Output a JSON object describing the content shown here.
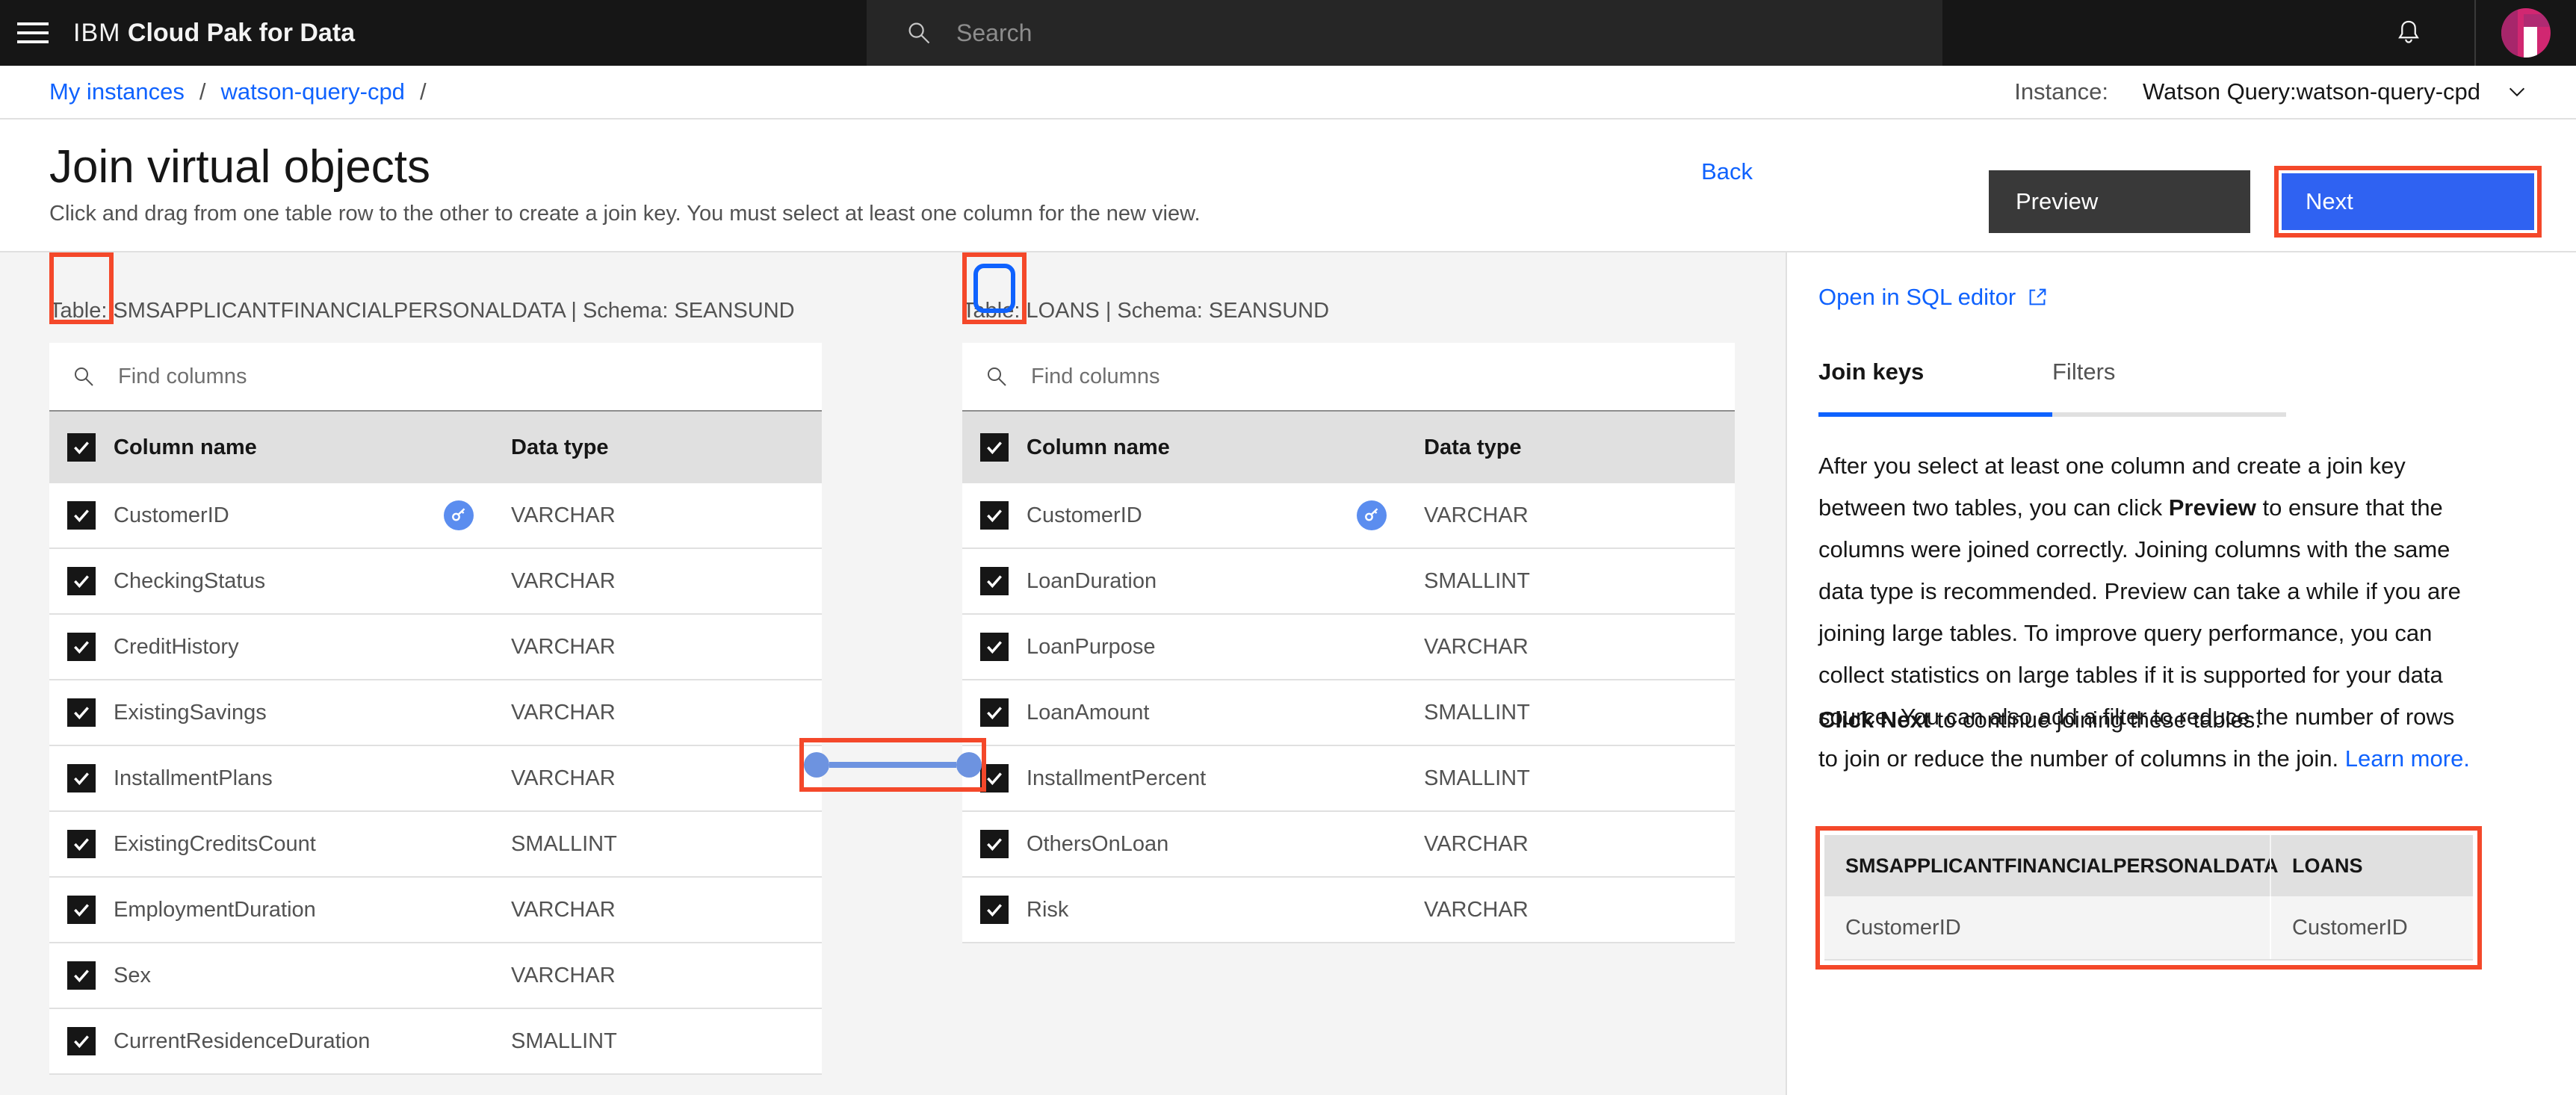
{
  "topbar": {
    "menu_icon": "hamburger-menu-icon",
    "brand_light": "IBM",
    "brand_bold": "Cloud Pak for Data",
    "search_placeholder": "Search",
    "search_icon": "search-icon",
    "notifications_icon": "bell-icon",
    "avatar": "user-avatar"
  },
  "breadcrumb": {
    "items": [
      {
        "label": "My instances"
      },
      {
        "label": "watson-query-cpd"
      }
    ],
    "separator": "/",
    "instance_label": "Instance:",
    "instance_value": "Watson Query:watson-query-cpd",
    "chevron_icon": "chevron-down-icon"
  },
  "page": {
    "title": "Join virtual objects",
    "subtitle": "Click and drag from one table row to the other to create a join key. You must select at least one column for the new view.",
    "back_label": "Back",
    "preview_label": "Preview",
    "next_label": "Next"
  },
  "tables": [
    {
      "caption": "Table: SMSAPPLICANTFINANCIALPERSONALDATA | Schema: SEANSUND",
      "find_placeholder": "Find columns",
      "find_icon": "search-icon",
      "header_col_name": "Column name",
      "header_col_type": "Data type",
      "header_checked": true,
      "rows": [
        {
          "name": "CustomerID",
          "type": "VARCHAR",
          "checked": true,
          "key": true
        },
        {
          "name": "CheckingStatus",
          "type": "VARCHAR",
          "checked": true,
          "key": false
        },
        {
          "name": "CreditHistory",
          "type": "VARCHAR",
          "checked": true,
          "key": false
        },
        {
          "name": "ExistingSavings",
          "type": "VARCHAR",
          "checked": true,
          "key": false
        },
        {
          "name": "InstallmentPlans",
          "type": "VARCHAR",
          "checked": true,
          "key": false
        },
        {
          "name": "ExistingCreditsCount",
          "type": "SMALLINT",
          "checked": true,
          "key": false
        },
        {
          "name": "EmploymentDuration",
          "type": "VARCHAR",
          "checked": true,
          "key": false
        },
        {
          "name": "Sex",
          "type": "VARCHAR",
          "checked": true,
          "key": false
        },
        {
          "name": "CurrentResidenceDuration",
          "type": "SMALLINT",
          "checked": true,
          "key": false
        }
      ]
    },
    {
      "caption": "Table: LOANS | Schema: SEANSUND",
      "find_placeholder": "Find columns",
      "find_icon": "search-icon",
      "header_col_name": "Column name",
      "header_col_type": "Data type",
      "header_checked": true,
      "rows": [
        {
          "name": "CustomerID",
          "type": "VARCHAR",
          "checked": true,
          "key": true
        },
        {
          "name": "LoanDuration",
          "type": "SMALLINT",
          "checked": true,
          "key": false
        },
        {
          "name": "LoanPurpose",
          "type": "VARCHAR",
          "checked": true,
          "key": false
        },
        {
          "name": "LoanAmount",
          "type": "SMALLINT",
          "checked": true,
          "key": false
        },
        {
          "name": "InstallmentPercent",
          "type": "SMALLINT",
          "checked": true,
          "key": false
        },
        {
          "name": "OthersOnLoan",
          "type": "VARCHAR",
          "checked": true,
          "key": false
        },
        {
          "name": "Risk",
          "type": "VARCHAR",
          "checked": true,
          "key": false
        }
      ]
    }
  ],
  "side_panel": {
    "sql_link": "Open in SQL editor",
    "sql_link_icon": "external-link-icon",
    "tabs": [
      {
        "label": "Join keys",
        "active": true
      },
      {
        "label": "Filters",
        "active": false
      }
    ],
    "body_1": "After you select at least one column and create a join key between two tables, you can click ",
    "body_bold_1": "Preview",
    "body_2": " to ensure that the columns were joined correctly. Joining columns with the same data type is recommended. Preview can take a while if you are joining large tables. To improve query performance, you can collect statistics on large tables if it is supported for your data source. You can also add a filter to reduce the number of rows to join or reduce the number of columns in the join. ",
    "learn_more": "Learn more.",
    "cta_bold": "Click Next",
    "cta_rest": " to continue joining these tables.",
    "join_keys_table": {
      "headers": [
        "SMSAPPLICANTFINANCIALPERSONALDATA",
        "LOANS"
      ],
      "rows": [
        [
          "CustomerID",
          "CustomerID"
        ]
      ]
    }
  },
  "colors": {
    "accent_blue": "#0f62fe",
    "highlight_red": "#f4482a",
    "header_dark": "#161616",
    "panel_gray": "#f4f4f4",
    "next_button": "#2f62f2"
  }
}
